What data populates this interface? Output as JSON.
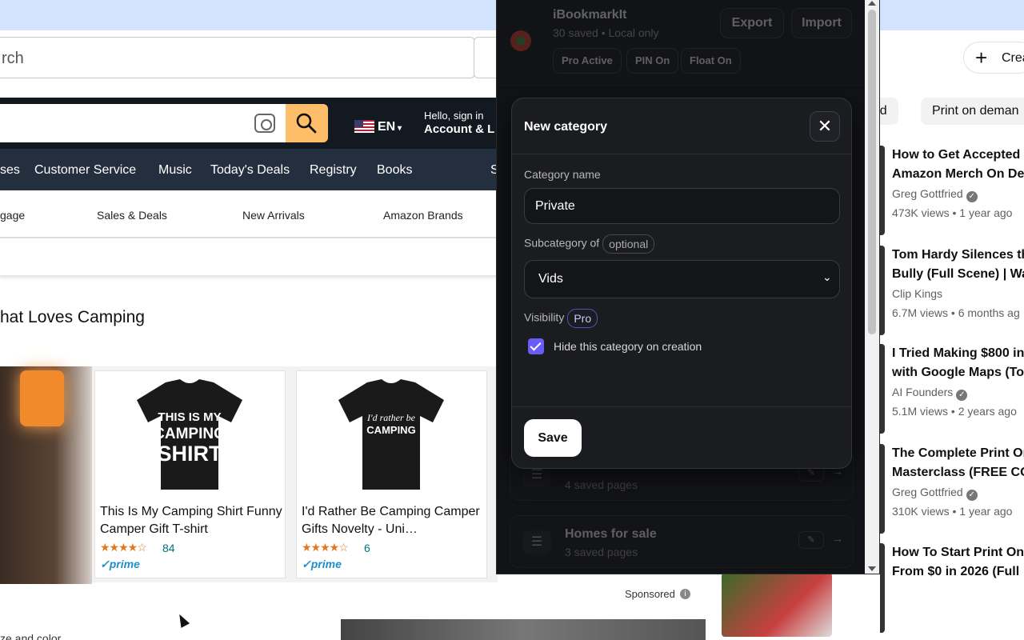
{
  "browser": {
    "search_placeholder_fragment": "rch"
  },
  "amazon": {
    "lang": "EN",
    "hello": "Hello, sign in",
    "account": "Account & L",
    "nav": [
      "ses",
      "Customer Service",
      "Music",
      "Today's Deals",
      "Registry",
      "Books",
      "S"
    ],
    "subnav": [
      "gage",
      "Sales & Deals",
      "New Arrivals",
      "Amazon Brands"
    ],
    "heading": "hat Loves Camping",
    "products": [
      {
        "shirt_text": "THIS IS MY CAMPING SHIRT",
        "title": "This Is My Camping Shirt Funny Camper Gift T-shirt",
        "stars": "★★★★☆",
        "rating_count": "84",
        "prime": "✓prime"
      },
      {
        "shirt_text": "I'd rather be CAMPING",
        "title": "I'd Rather Be Camping Camper Gifts Novelty - Uni…",
        "stars": "★★★★☆",
        "rating_count": "6",
        "prime": "✓prime"
      }
    ],
    "sponsored": "Sponsored",
    "size_color": "ze and color"
  },
  "youtube": {
    "create": "Crea",
    "chips": [
      "ried",
      "Print on deman"
    ],
    "videos": [
      {
        "title_1": "How to Get Accepted",
        "title_2": "Amazon Merch On De",
        "channel": "Greg Gottfried",
        "verified": true,
        "meta": "473K views • 1 year ago"
      },
      {
        "title_1": "Tom Hardy Silences th",
        "title_2": "Bully (Full Scene) | Wa",
        "channel": "Clip Kings",
        "verified": false,
        "meta": "6.7M views • 6 months ag"
      },
      {
        "title_1": "I Tried Making $800 in",
        "title_2": "with Google Maps (To",
        "channel": "AI Founders",
        "verified": true,
        "meta": "5.1M views • 2 years ago"
      },
      {
        "title_1": "The Complete Print On",
        "title_2": "Masterclass (FREE CO",
        "channel": "Greg Gottfried",
        "verified": true,
        "meta": "310K views • 1 year ago"
      },
      {
        "title_1": "How To Start Print On",
        "title_2": "From $0 in 2026 (Full",
        "channel": "",
        "verified": false,
        "meta": ""
      }
    ]
  },
  "extension": {
    "title": "iBookmarkIt",
    "subtitle": "30 saved • Local only",
    "export_label": "Export",
    "import_label": "Import",
    "pills": [
      "Pro Active",
      "PIN On",
      "Float On"
    ],
    "bg_categories": [
      {
        "name": "",
        "count": "4 saved pages"
      },
      {
        "name": "Homes for sale",
        "count": "3 saved pages"
      }
    ],
    "modal": {
      "title": "New category",
      "close_label": "✕",
      "name_label": "Category name",
      "name_value": "Private",
      "subcategory_label": "Subcategory of",
      "optional_tag": "optional",
      "subcategory_value": "Vids",
      "visibility_label": "Visibility",
      "pro_tag": "Pro",
      "hide_checked": true,
      "hide_label": "Hide this category on creation",
      "save_label": "Save"
    }
  },
  "colors": {
    "amazon_dark": "#131921",
    "amazon_nav": "#232f3e",
    "amazon_search_btn": "#febd69",
    "ext_bg": "#121316",
    "modal_bg": "#1b1c20",
    "checkbox_accent": "#6a5cf6"
  }
}
